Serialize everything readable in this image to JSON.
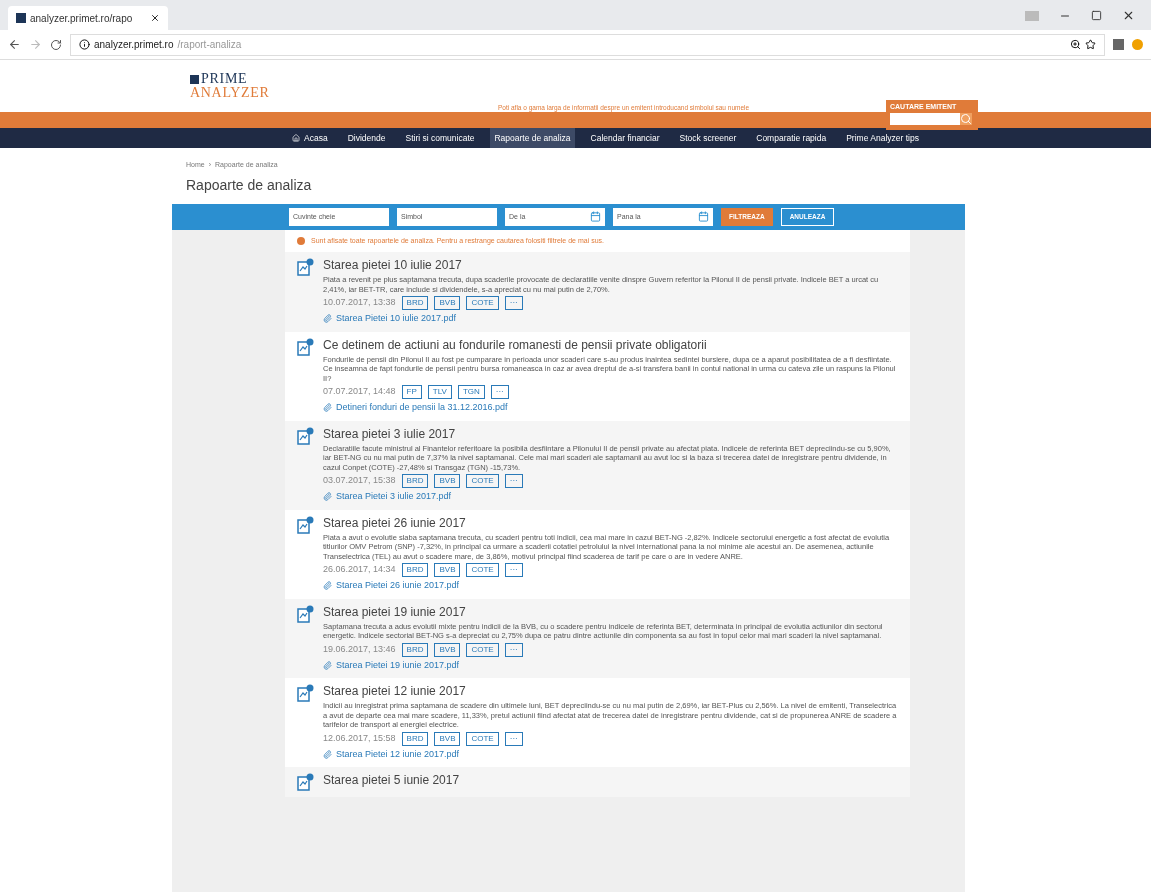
{
  "browser": {
    "tab_title": "analyzer.primet.ro/rapo",
    "url_host": "analyzer.primet.ro",
    "url_path": "/raport-analiza"
  },
  "header": {
    "logo_top": "PRIME",
    "logo_bottom": "ANALYZER",
    "tagline": "Poti afla o gama larga de informatii despre un emitent introducand simbolul sau numele",
    "search_label": "CAUTARE EMITENT"
  },
  "nav": [
    {
      "label": "Acasa",
      "selected": false,
      "kind": "home"
    },
    {
      "label": "Dividende",
      "selected": false,
      "kind": "link"
    },
    {
      "label": "Stiri si comunicate",
      "selected": false,
      "kind": "link"
    },
    {
      "label": "Rapoarte de analiza",
      "selected": true,
      "kind": "link"
    },
    {
      "label": "Calendar financiar",
      "selected": false,
      "kind": "link"
    },
    {
      "label": "Stock screener",
      "selected": false,
      "kind": "link"
    },
    {
      "label": "Comparatie rapida",
      "selected": false,
      "kind": "link"
    },
    {
      "label": "Prime Analyzer tips",
      "selected": false,
      "kind": "link"
    }
  ],
  "breadcrumb": [
    "Home",
    "›",
    "Rapoarte de analiza"
  ],
  "page_title": "Rapoarte de analiza",
  "filters": {
    "fields": [
      {
        "placeholder": "Cuvinte cheie",
        "kind": "text"
      },
      {
        "placeholder": "Simbol",
        "kind": "text"
      },
      {
        "placeholder": "De la",
        "kind": "date"
      },
      {
        "placeholder": "Pana la",
        "kind": "date"
      }
    ],
    "buttons": [
      {
        "label": "FILTREAZA",
        "kind": "primary"
      },
      {
        "label": "ANULEAZA",
        "kind": "secondary"
      }
    ]
  },
  "notice": "Sunt afisate toate rapoartele de analiza. Pentru a restrange cautarea folositi filtrele de mai sus.",
  "reports": [
    {
      "title": "Starea pietei 10 iulie 2017",
      "text": "Piata a revenit pe plus saptamana trecuta, dupa scaderile provocate de declaratiile venite dinspre Guvern referitor la Pilonul II de pensii private. Indicele BET a urcat cu 2,41%, iar BET-TR, care include si dividendele, s-a apreciat cu nu mai putin de 2,70%.",
      "date": "10.07.2017, 13:38",
      "tags": [
        "BRD",
        "BVB",
        "COTE",
        "···"
      ],
      "file": "Starea Pietei 10 iulie 2017.pdf"
    },
    {
      "title": "Ce detinem de actiuni au fondurile romanesti de pensii private obligatorii",
      "text": "Fondurile de pensii din Pilonul II au fost pe cumparare in perioada unor scaderi care s-au produs inaintea sedintei bursiere, dupa ce a aparut posibilitatea de a fi desfiintate. Ce inseamna de fapt fondurile de pensii pentru bursa romaneasca in caz ar avea dreptul de a-si transfera banii in contul national in urma cu cateva zile un raspuns la Pilonul II?",
      "date": "07.07.2017, 14:48",
      "tags": [
        "FP",
        "TLV",
        "TGN",
        "···"
      ],
      "file": "Detineri fonduri de pensii la 31.12.2016.pdf"
    },
    {
      "title": "Starea pietei 3 iulie 2017",
      "text": "Declaratiile facute ministrul al Finantelor referitoare la posibila desfiintare a Pilonului II de pensii private au afectat piata. Indicele de referinta BET depreciindu-se cu 5,90%, iar BET-NG cu nu mai putin de 7,37% la nivel saptamanal. Cele mai mari scaderi ale saptamanii au avut loc si la baza si trecerea datei de inregistrare pentru dividende, in cazul Conpet (COTE) -27,48% si Transgaz (TGN) -15,73%.",
      "date": "03.07.2017, 15:38",
      "tags": [
        "BRD",
        "BVB",
        "COTE",
        "···"
      ],
      "file": "Starea Pietei 3 iulie 2017.pdf"
    },
    {
      "title": "Starea pietei 26 iunie 2017",
      "text": "Piata a avut o evolutie slaba saptamana trecuta, cu scaderi pentru toti indicii, cea mai mare in cazul BET-NG -2,82%. Indicele sectorului energetic a fost afectat de evolutia titlurilor OMV Petrom (SNP) -7,32%, in principal ca urmare a scaderii cotatiei petrolului la nivel international pana la noi minime ale acestui an. De asemenea, actiunile Transelectrica (TEL) au avut o scadere mare, de 3,86%, motivul principal fiind scaderea de tarif pe care o are in vedere ANRE.",
      "date": "26.06.2017, 14:34",
      "tags": [
        "BRD",
        "BVB",
        "COTE",
        "···"
      ],
      "file": "Starea Pietei 26 iunie 2017.pdf"
    },
    {
      "title": "Starea pietei 19 iunie 2017",
      "text": "Saptamana trecuta a adus evolutii mixte pentru indicii de la BVB, cu o scadere pentru indicele de referinta BET, determinata in principal de evolutia actiunilor din sectorul energetic. Indicele sectorial BET-NG s-a depreciat cu 2,75% dupa ce patru dintre actiunile din componenta sa au fost in topul celor mai mari scaderi la nivel saptamanal.",
      "date": "19.06.2017, 13:46",
      "tags": [
        "BRD",
        "BVB",
        "COTE",
        "···"
      ],
      "file": "Starea Pietei 19 iunie 2017.pdf"
    },
    {
      "title": "Starea pietei 12 iunie 2017",
      "text": "Indicii au inregistrat prima saptamana de scadere din ultimele luni, BET depreciindu-se cu nu mai putin de 2,69%, iar BET-Plus cu 2,56%. La nivel de emitenti, Transelectrica a avut de departe cea mai mare scadere, 11,33%, pretul actiunii fiind afectat atat de trecerea datei de inregistrare pentru dividende, cat si de propunerea ANRE de scadere a tarifelor de transport al energiei electrice.",
      "date": "12.06.2017, 15:58",
      "tags": [
        "BRD",
        "BVB",
        "COTE",
        "···"
      ],
      "file": "Starea Pietei 12 iunie 2017.pdf"
    },
    {
      "title": "Starea pietei 5 iunie 2017"
    }
  ]
}
